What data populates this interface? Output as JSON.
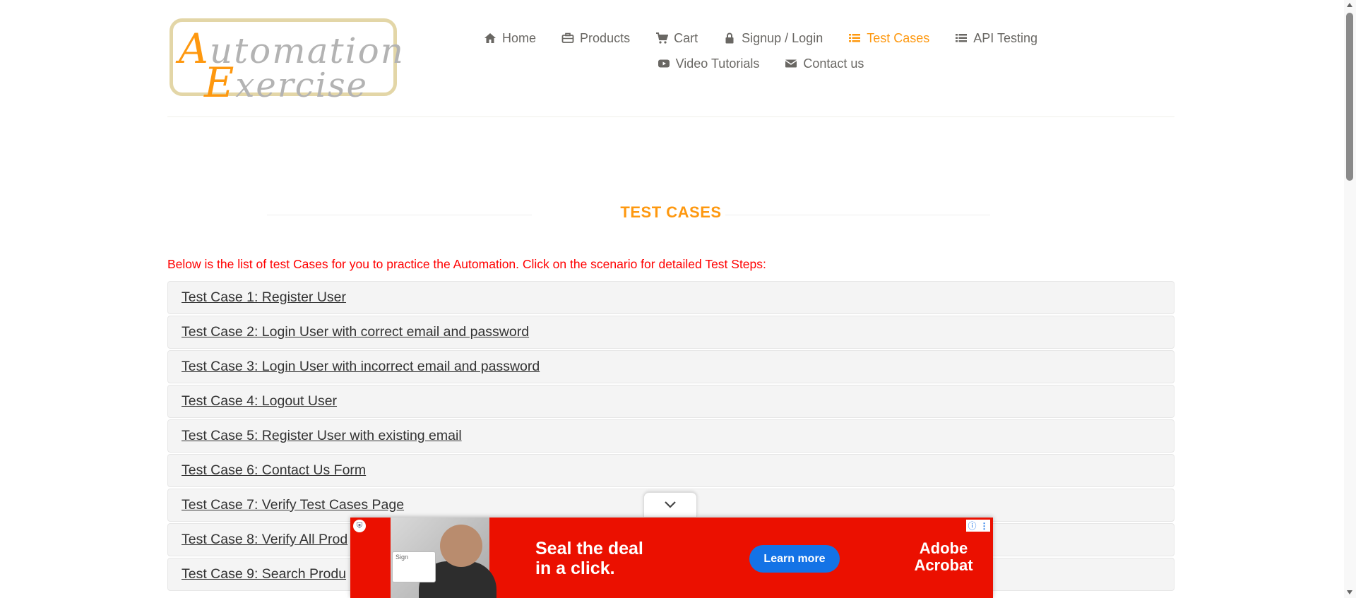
{
  "logo": {
    "line1_first": "A",
    "line1_rest": "utomation",
    "line2_first": "E",
    "line2_rest": "xercise"
  },
  "nav": {
    "row1": [
      {
        "label": "Home",
        "icon": "home-icon",
        "active": false
      },
      {
        "label": "Products",
        "icon": "briefcase-icon",
        "active": false
      },
      {
        "label": "Cart",
        "icon": "cart-icon",
        "active": false
      },
      {
        "label": "Signup / Login",
        "icon": "lock-icon",
        "active": false
      },
      {
        "label": "Test Cases",
        "icon": "list-icon",
        "active": true
      },
      {
        "label": "API Testing",
        "icon": "list-icon",
        "active": false
      }
    ],
    "row2": [
      {
        "label": "Video Tutorials",
        "icon": "youtube-icon",
        "active": false
      },
      {
        "label": "Contact us",
        "icon": "envelope-icon",
        "active": false
      }
    ]
  },
  "page": {
    "title": "TEST CASES",
    "intro": "Below is the list of test Cases for you to practice the Automation. Click on the scenario for detailed Test Steps:"
  },
  "test_cases": [
    "Test Case 1: Register User",
    "Test Case 2: Login User with correct email and password",
    "Test Case 3: Login User with incorrect email and password",
    "Test Case 4: Logout User",
    "Test Case 5: Register User with existing email",
    "Test Case 6: Contact Us Form",
    "Test Case 7: Verify Test Cases Page",
    "Test Case 8: Verify All Prod",
    "Test Case 9: Search Produ"
  ],
  "ad": {
    "headline_line1": "Seal the deal",
    "headline_line2": "in a click.",
    "cta": "Learn more",
    "brand_line1": "Adobe",
    "brand_line2": "Acrobat",
    "card_text": "Sign"
  },
  "colors": {
    "accent": "#fe980f",
    "intro_red": "#ff0000",
    "ad_red": "#eb1000",
    "ad_button": "#1473e6"
  }
}
